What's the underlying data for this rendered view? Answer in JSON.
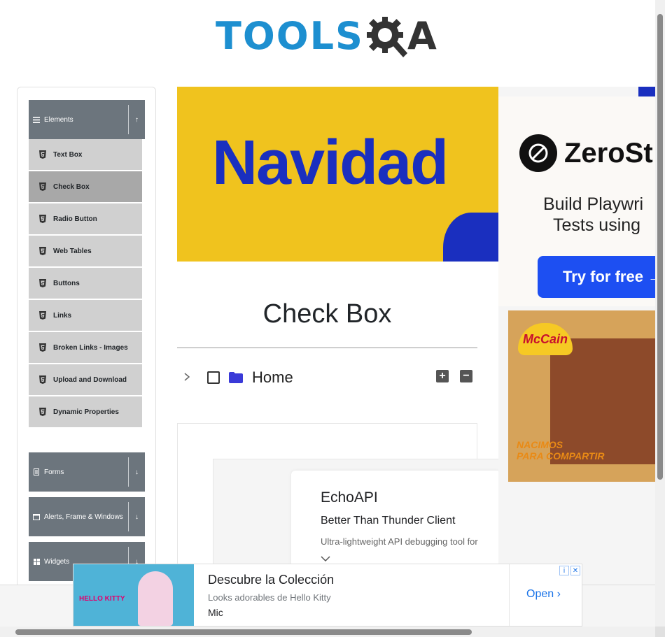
{
  "logo": {
    "tools_text": "TOOLS",
    "qa_text": "A"
  },
  "sidebar": {
    "groups": [
      {
        "label": "Elements",
        "icon": "hamburger-icon",
        "toggle": "up-arrow-icon",
        "expanded": true
      },
      {
        "label": "Forms",
        "icon": "form-icon",
        "toggle": "down-arrow-icon",
        "expanded": false
      },
      {
        "label": "Alerts, Frame & Windows",
        "icon": "window-icon",
        "toggle": "down-arrow-icon",
        "expanded": false
      },
      {
        "label": "Widgets",
        "icon": "grid-icon",
        "toggle": "down-arrow-icon",
        "expanded": false
      }
    ],
    "items": [
      {
        "label": "Text Box",
        "active": false
      },
      {
        "label": "Check Box",
        "active": true
      },
      {
        "label": "Radio Button",
        "active": false
      },
      {
        "label": "Web Tables",
        "active": false
      },
      {
        "label": "Buttons",
        "active": false
      },
      {
        "label": "Links",
        "active": false
      },
      {
        "label": "Broken Links - Images",
        "active": false
      },
      {
        "label": "Upload and Download",
        "active": false
      },
      {
        "label": "Dynamic Properties",
        "active": false
      }
    ]
  },
  "banner": {
    "text": "Navidad"
  },
  "main": {
    "title": "Check Box",
    "tree": {
      "root_label": "Home",
      "checked": false,
      "expand_all": "+",
      "collapse_all": "−"
    }
  },
  "echo_ad": {
    "title": "EchoAPI",
    "subtitle": "Better Than Thunder Client",
    "description": "Ultra-lightweight API debugging tool for"
  },
  "right_ad": {
    "brand": "ZeroSt",
    "line1": "Build Playwri",
    "line2": "Tests using",
    "cta": "Try for free →",
    "mccain_logo": "McCain",
    "mccain_tag_1": "NACIMOS",
    "mccain_tag_2": "PARA COMPARTIR"
  },
  "bottom_ad": {
    "title": "Descubre la Colección",
    "subtitle": "Looks adorables de Hello Kitty",
    "brand": "Mic",
    "cta": "Open",
    "image_text": "HELLO KITTY"
  },
  "colors": {
    "brand_blue": "#1d8fd0",
    "sidebar_header": "#6c757d",
    "menu_item": "#d0d0d0",
    "menu_active": "#a8a8a8",
    "banner_yellow": "#f0c31e",
    "banner_blue": "#1a2fbf",
    "cta_blue": "#1d4ff2",
    "link_blue": "#1a73e8"
  }
}
